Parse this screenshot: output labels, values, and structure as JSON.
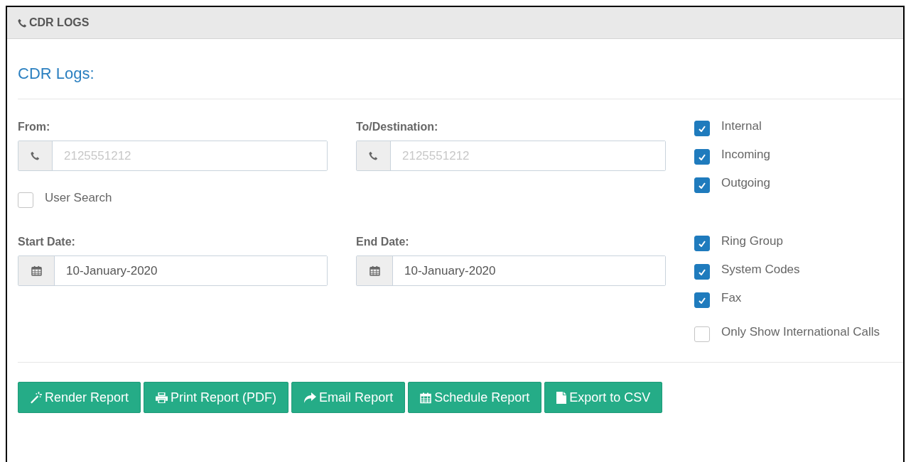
{
  "panel": {
    "title": "CDR LOGS"
  },
  "heading": "CDR Logs:",
  "fields": [
    {
      "label": "From:",
      "kind": "phone",
      "placeholder": "2125551212"
    },
    {
      "label": "To/Destination:",
      "kind": "phone",
      "placeholder": "2125551212"
    },
    {
      "label": "Start Date:",
      "kind": "date",
      "value": "10-January-2020"
    },
    {
      "label": "End Date:",
      "kind": "date",
      "value": "10-January-2020"
    }
  ],
  "user_search": {
    "label": "User Search",
    "checked": false
  },
  "filter_groups": [
    {
      "items": [
        {
          "label": "Internal",
          "checked": true
        },
        {
          "label": "Incoming",
          "checked": true
        },
        {
          "label": "Outgoing",
          "checked": true
        }
      ]
    },
    {
      "items": [
        {
          "label": "Ring Group",
          "checked": true
        },
        {
          "label": "System Codes",
          "checked": true
        },
        {
          "label": "Fax",
          "checked": true
        }
      ]
    },
    {
      "items": [
        {
          "label": "Only Show International Calls",
          "checked": false
        }
      ]
    }
  ],
  "buttons": [
    {
      "label": "Render Report",
      "kind": "wand"
    },
    {
      "label": "Print Report (PDF)",
      "kind": "print"
    },
    {
      "label": "Email Report",
      "kind": "share"
    },
    {
      "label": "Schedule Report",
      "kind": "calendar"
    },
    {
      "label": "Export to CSV",
      "kind": "file"
    }
  ]
}
